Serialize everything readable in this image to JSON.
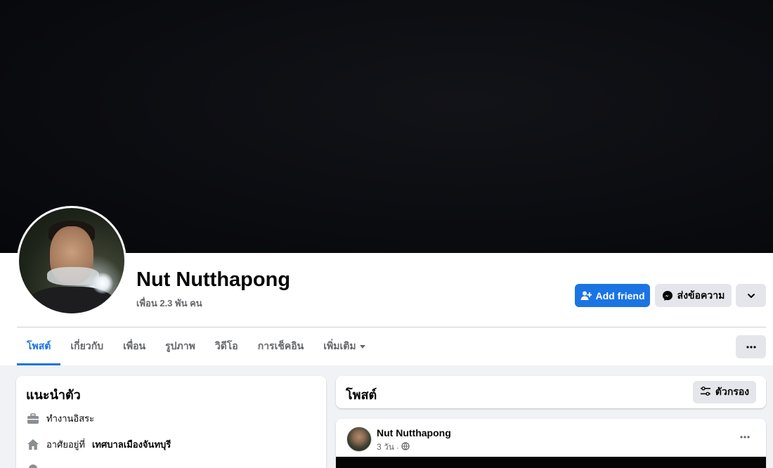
{
  "profile": {
    "name": "Nut Nutthapong",
    "friends": "เพื่อน 2.3 พัน คน"
  },
  "actions": {
    "add_friend": "Add friend",
    "message": "ส่งข้อความ"
  },
  "tabs": [
    {
      "label": "โพสต์",
      "active": true
    },
    {
      "label": "เกี่ยวกับ"
    },
    {
      "label": "เพื่อน"
    },
    {
      "label": "รูปภาพ"
    },
    {
      "label": "วิดีโอ"
    },
    {
      "label": "การเช็คอิน"
    },
    {
      "label": "เพิ่มเติม"
    }
  ],
  "intro": {
    "title": "แนะนำตัว",
    "work": "ทำงานอิสระ",
    "lives_prefix": "อาศัยอยู่ที่",
    "lives_place": "เทศบาลเมืองจันทบุรี"
  },
  "posts": {
    "title": "โพสต์",
    "filter_label": "ตัวกรอง"
  },
  "post": {
    "author": "Nut Nutthapong",
    "time": "3 วัน",
    "separator": "·"
  },
  "colors": {
    "accent": "#1b74e4",
    "button_gray": "#e4e6eb",
    "text_secondary": "#65676b"
  }
}
